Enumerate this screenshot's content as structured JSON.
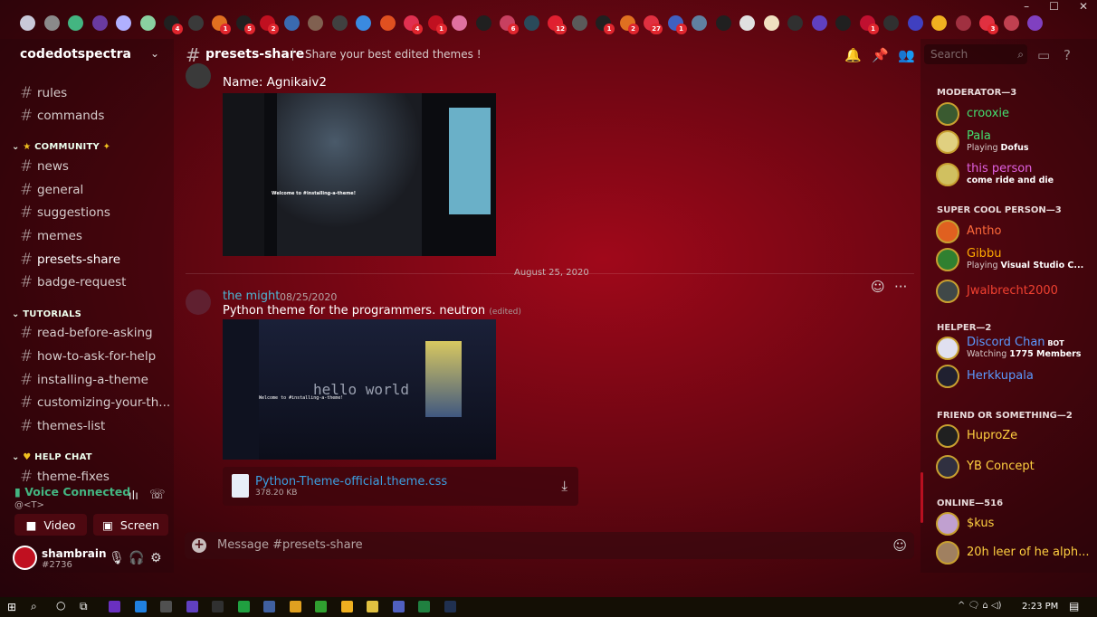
{
  "window": {
    "minimize": "–",
    "maximize": "☐",
    "close": "✕"
  },
  "server_bar": {
    "icons": [
      {
        "name": "discord-icon",
        "color": "#c8c8d8"
      },
      {
        "name": "pub-server-icon",
        "color": "#8a8a8a"
      },
      {
        "name": "green-server-icon",
        "color": "#43b581"
      },
      {
        "name": "server-icon",
        "color": "#6a3aa0"
      },
      {
        "name": "server-icon",
        "color": "#b0b0ff"
      },
      {
        "name": "server-icon",
        "color": "#8ad0a0"
      },
      {
        "name": "server-icon",
        "color": "#202020",
        "badge": "4"
      },
      {
        "name": "server-icon",
        "color": "#3a3a3a"
      },
      {
        "name": "server-icon",
        "color": "#e07020",
        "badge": "1"
      },
      {
        "name": "server-icon",
        "color": "#202020",
        "badge": "5"
      },
      {
        "name": "server-icon",
        "color": "#c01020",
        "badge": "2"
      },
      {
        "name": "server-icon",
        "color": "#3a6ab0"
      },
      {
        "name": "server-icon",
        "color": "#806050"
      },
      {
        "name": "server-icon",
        "color": "#404040"
      },
      {
        "name": "server-icon",
        "color": "#3a8ae0"
      },
      {
        "name": "server-icon",
        "color": "#e05020"
      },
      {
        "name": "server-icon",
        "color": "#e03050",
        "badge": "4"
      },
      {
        "name": "server-icon",
        "color": "#c01020",
        "badge": "1"
      },
      {
        "name": "server-icon",
        "color": "#e070a0"
      },
      {
        "name": "server-icon",
        "color": "#202020"
      },
      {
        "name": "server-icon",
        "color": "#c84060",
        "badge": "6"
      },
      {
        "name": "server-icon",
        "color": "#2a4a5a"
      },
      {
        "name": "server-icon",
        "color": "#e02030",
        "badge": "12"
      },
      {
        "name": "server-icon",
        "color": "#5a5a5a"
      },
      {
        "name": "server-icon",
        "color": "#202020",
        "badge": "1"
      },
      {
        "name": "server-icon",
        "color": "#e07020",
        "badge": "2"
      },
      {
        "name": "server-icon",
        "color": "#e03040",
        "badge": "27"
      },
      {
        "name": "server-icon",
        "color": "#4060c0",
        "badge": "1"
      },
      {
        "name": "server-icon",
        "color": "#6080a0"
      },
      {
        "name": "server-icon",
        "color": "#202020"
      },
      {
        "name": "server-icon",
        "color": "#e0e0e0"
      },
      {
        "name": "server-icon",
        "color": "#f0e0c0"
      },
      {
        "name": "server-icon",
        "color": "#303030"
      },
      {
        "name": "server-icon",
        "color": "#6040c0"
      },
      {
        "name": "server-icon",
        "color": "#202020"
      },
      {
        "name": "server-icon",
        "color": "#c01030",
        "badge": "1"
      },
      {
        "name": "server-icon",
        "color": "#303030"
      },
      {
        "name": "folder-icon",
        "color": "#4040c0"
      },
      {
        "name": "server-icon",
        "color": "#f0b020"
      },
      {
        "name": "server-icon",
        "color": "#a03040"
      },
      {
        "name": "server-icon",
        "color": "#e03040",
        "badge": "3"
      },
      {
        "name": "add-server-icon",
        "color": "#c04050"
      },
      {
        "name": "explore-icon",
        "color": "#8040c0"
      }
    ]
  },
  "sidebar": {
    "server_name": "codedotspectra",
    "channels_top": [
      {
        "name": "rules"
      },
      {
        "name": "commands"
      }
    ],
    "cat_community": "COMMUNITY",
    "community": [
      {
        "name": "news"
      },
      {
        "name": "general"
      },
      {
        "name": "suggestions"
      },
      {
        "name": "memes"
      },
      {
        "name": "presets-share",
        "active": true
      },
      {
        "name": "badge-request"
      }
    ],
    "cat_tutorials": "TUTORIALS",
    "tutorials": [
      {
        "name": "read-before-asking"
      },
      {
        "name": "how-to-ask-for-help"
      },
      {
        "name": "installing-a-theme"
      },
      {
        "name": "customizing-your-th..."
      },
      {
        "name": "themes-list"
      }
    ],
    "cat_help": "HELP CHAT",
    "help": [
      {
        "name": "theme-fixes"
      }
    ]
  },
  "voice": {
    "status": "Voice Connected",
    "sub": "@<T>",
    "video": "Video",
    "screen": "Screen"
  },
  "user": {
    "name": "shambrain",
    "tag": "#2736"
  },
  "header": {
    "channel": "presets-share",
    "topic": "Share your best edited themes !",
    "search_placeholder": "Search"
  },
  "messages": {
    "first_text": "Name: Agnikaiv2",
    "date_separator": "August 25, 2020",
    "author": "the might",
    "timestamp": "08/25/2020",
    "text": "Python theme for the programmers. neutron",
    "edited": "(edited)",
    "screenshot1_title": "Welcome to #installing-a-theme!",
    "screenshot2_title": "Welcome to #installing-a-theme!",
    "screenshot2_overlay": "hello world",
    "file": {
      "name": "Python-Theme-official.theme.css",
      "size": "378.20 KB"
    }
  },
  "composer": {
    "placeholder": "Message #presets-share"
  },
  "members": {
    "groups": [
      {
        "label": "MODERATOR—3",
        "members": [
          {
            "name": "crooxie",
            "color": "#43e070",
            "avatar": "#3a5a30"
          },
          {
            "name": "Pala",
            "color": "#43e070",
            "activity_prefix": "Playing",
            "activity": "Dofus",
            "avatar": "#e0d080"
          },
          {
            "name": "this person",
            "color": "#e060e0",
            "activity": "come ride and die",
            "avatar": "#d0c060"
          }
        ]
      },
      {
        "label": "SUPER COOL PERSON—3",
        "members": [
          {
            "name": "Antho",
            "color": "#ff6a3a",
            "avatar": "#e06020"
          },
          {
            "name": "Gibbu",
            "color": "#ffaa00",
            "activity_prefix": "Playing",
            "activity": "Visual Studio C...",
            "avatar": "#308030"
          },
          {
            "name": "Jwalbrecht2000",
            "color": "#f04030",
            "avatar": "#404848"
          }
        ]
      },
      {
        "label": "HELPER—2",
        "members": [
          {
            "name": "Discord Chan",
            "color": "#5a9aff",
            "badge": "BOT",
            "activity_prefix": "Watching",
            "activity": "1775 Members",
            "avatar": "#e0e0f0"
          },
          {
            "name": "Herkkupala",
            "color": "#5a9aff",
            "avatar": "#202030"
          }
        ]
      },
      {
        "label": "FRIEND OR SOMETHING—2",
        "members": [
          {
            "name": "HuproZe",
            "color": "#ffd040",
            "avatar": "#202020"
          },
          {
            "name": "YB Concept",
            "color": "#ffd040",
            "avatar": "#303040"
          }
        ]
      },
      {
        "label": "ONLINE—516",
        "members": [
          {
            "name": "$kus",
            "color": "#ffd040",
            "avatar": "#c0a0d0"
          },
          {
            "name": "20h leer of he alph...",
            "color": "#ffd040",
            "avatar": "#a08060"
          }
        ]
      }
    ]
  },
  "taskbar": {
    "time": "2:23 PM",
    "tray": "^ 🗨 ⌂ ◁) "
  }
}
